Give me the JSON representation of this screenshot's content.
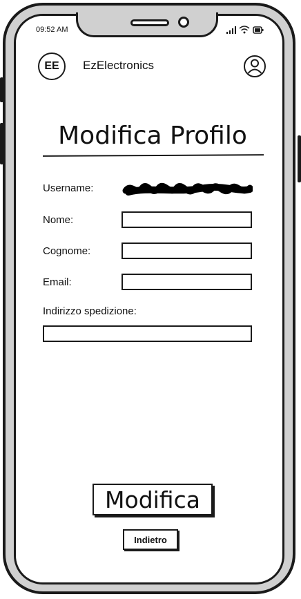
{
  "status_bar": {
    "time": "09:52 AM",
    "icons": [
      "signal-icon",
      "wifi-icon",
      "battery-icon"
    ]
  },
  "header": {
    "logo_text": "EE",
    "app_name": "EzElectronics",
    "account_icon": "user-circle-icon"
  },
  "page": {
    "title": "Modifica Profilo"
  },
  "form": {
    "username_label": "Username:",
    "nome_label": "Nome:",
    "nome_value": "",
    "cognome_label": "Cognome:",
    "cognome_value": "",
    "email_label": "Email:",
    "email_value": "",
    "indirizzo_label": "Indirizzo spedizione:",
    "indirizzo_value": ""
  },
  "actions": {
    "submit_label": "Modifica",
    "back_label": "Indietro"
  }
}
